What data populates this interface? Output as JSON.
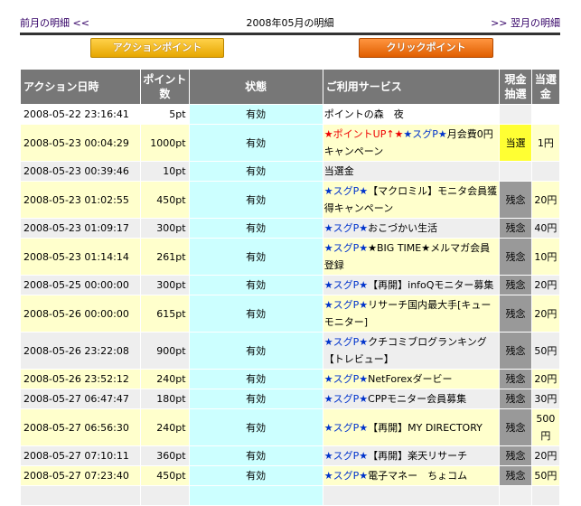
{
  "nav": {
    "prev": "前月の明細 <<",
    "title": "2008年05月の明細",
    "next": ">> 翌月の明細"
  },
  "buttons": {
    "action": "アクションポイント",
    "click": "クリックポイント"
  },
  "table": {
    "headers": {
      "date": "アクション日時",
      "points": "ポイント数",
      "status": "状態",
      "service": "ご利用サービス",
      "lottery": "現金抽選",
      "prize": "当選金"
    },
    "rows": [
      {
        "date": "2008-05-22 23:16:41",
        "points": "5pt",
        "status": "有効",
        "service": [
          {
            "t": "ポイントの森　夜",
            "c": "blk"
          }
        ],
        "result": "",
        "prize": "",
        "bg": "w",
        "rclass": "none"
      },
      {
        "date": "2008-05-23 00:04:29",
        "points": "1000pt",
        "status": "有効",
        "service": [
          {
            "t": "★ポイントUP↑★",
            "c": "red"
          },
          {
            "t": "★スグP★",
            "c": "blue"
          },
          {
            "t": "月会費0円キャンペーン",
            "c": "blk"
          }
        ],
        "result": "当選",
        "prize": "1円",
        "bg": "y",
        "rclass": "win"
      },
      {
        "date": "2008-05-23 00:39:46",
        "points": "10pt",
        "status": "有効",
        "service": [
          {
            "t": "当選金",
            "c": "blk"
          }
        ],
        "result": "",
        "prize": "",
        "bg": "g",
        "rclass": "none"
      },
      {
        "date": "2008-05-23 01:02:55",
        "points": "450pt",
        "status": "有効",
        "service": [
          {
            "t": "★スグP★",
            "c": "blue"
          },
          {
            "t": "【マクロミル】モニタ会員獲得キャンペーン",
            "c": "blk"
          }
        ],
        "result": "残念",
        "prize": "20円",
        "bg": "y",
        "rclass": ""
      },
      {
        "date": "2008-05-23 01:09:17",
        "points": "300pt",
        "status": "有効",
        "service": [
          {
            "t": "★スグP★",
            "c": "blue"
          },
          {
            "t": "おこづかい生活",
            "c": "blk"
          }
        ],
        "result": "残念",
        "prize": "40円",
        "bg": "g",
        "rclass": ""
      },
      {
        "date": "2008-05-23 01:14:14",
        "points": "261pt",
        "status": "有効",
        "service": [
          {
            "t": "★スグP★",
            "c": "blue"
          },
          {
            "t": "★BIG TIME★メルマガ会員登録",
            "c": "blk"
          }
        ],
        "result": "残念",
        "prize": "10円",
        "bg": "y",
        "rclass": ""
      },
      {
        "date": "2008-05-25 00:00:00",
        "points": "300pt",
        "status": "有効",
        "service": [
          {
            "t": "★スグP★",
            "c": "blue"
          },
          {
            "t": "【再開】infoQモニター募集",
            "c": "blk"
          }
        ],
        "result": "残念",
        "prize": "20円",
        "bg": "g",
        "rclass": ""
      },
      {
        "date": "2008-05-26 00:00:00",
        "points": "615pt",
        "status": "有効",
        "service": [
          {
            "t": "★スグP★",
            "c": "blue"
          },
          {
            "t": "リサーチ国内最大手[キューモニター]",
            "c": "blk"
          }
        ],
        "result": "残念",
        "prize": "20円",
        "bg": "y",
        "rclass": ""
      },
      {
        "date": "2008-05-26 23:22:08",
        "points": "900pt",
        "status": "有効",
        "service": [
          {
            "t": "★スグP★",
            "c": "blue"
          },
          {
            "t": "クチコミブログランキング【トレビュー】",
            "c": "blk"
          }
        ],
        "result": "残念",
        "prize": "50円",
        "bg": "g",
        "rclass": ""
      },
      {
        "date": "2008-05-26 23:52:12",
        "points": "240pt",
        "status": "有効",
        "service": [
          {
            "t": "★スグP★",
            "c": "blue"
          },
          {
            "t": "NetForexダービー",
            "c": "blk"
          }
        ],
        "result": "残念",
        "prize": "20円",
        "bg": "y",
        "rclass": ""
      },
      {
        "date": "2008-05-27 06:47:47",
        "points": "180pt",
        "status": "有効",
        "service": [
          {
            "t": "★スグP★",
            "c": "blue"
          },
          {
            "t": "CPPモニター会員募集",
            "c": "blk"
          }
        ],
        "result": "残念",
        "prize": "30円",
        "bg": "g",
        "rclass": ""
      },
      {
        "date": "2008-05-27 06:56:30",
        "points": "240pt",
        "status": "有効",
        "service": [
          {
            "t": "★スグP★",
            "c": "blue"
          },
          {
            "t": "【再開】MY DIRECTORY",
            "c": "blk"
          }
        ],
        "result": "残念",
        "prize": "500円",
        "bg": "y",
        "rclass": ""
      },
      {
        "date": "2008-05-27 07:10:11",
        "points": "360pt",
        "status": "有効",
        "service": [
          {
            "t": "★スグP★",
            "c": "blue"
          },
          {
            "t": "【再開】楽天リサーチ",
            "c": "blk"
          }
        ],
        "result": "残念",
        "prize": "20円",
        "bg": "g",
        "rclass": ""
      },
      {
        "date": "2008-05-27 07:23:40",
        "points": "450pt",
        "status": "有効",
        "service": [
          {
            "t": "★スグP★",
            "c": "blue"
          },
          {
            "t": "電子マネー　ちょコム",
            "c": "blk"
          }
        ],
        "result": "残念",
        "prize": "50円",
        "bg": "y",
        "rclass": ""
      }
    ]
  },
  "colors": {
    "header_bg": "#777777",
    "status_bg": "#ccffff",
    "row_yellow": "#ffffcc",
    "row_gray": "#eeeeee",
    "lose_bg": "#999999",
    "win_bg": "#ffff33",
    "link": "#330066",
    "service_tag": "#0033cc",
    "highlight_red": "#ee0000"
  }
}
